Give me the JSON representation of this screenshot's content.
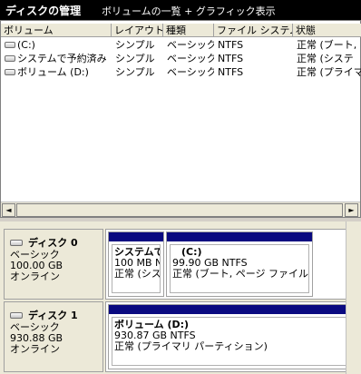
{
  "titlebar": {
    "title": "ディスクの管理",
    "view": "ボリュームの一覧 + グラフィック表示"
  },
  "columns": [
    {
      "label": "ボリューム"
    },
    {
      "label": "レイアウト"
    },
    {
      "label": "種類"
    },
    {
      "label": "ファイル システム"
    },
    {
      "label": "状態"
    }
  ],
  "volumes": [
    {
      "name": "(C:)",
      "layout": "シンプル",
      "type": "ベーシック",
      "fs": "NTFS",
      "status": "正常 (ブート,"
    },
    {
      "name": "システムで予約済み",
      "layout": "シンプル",
      "type": "ベーシック",
      "fs": "NTFS",
      "status": "正常 (システ"
    },
    {
      "name": "ボリューム (D:)",
      "layout": "シンプル",
      "type": "ベーシック",
      "fs": "NTFS",
      "status": "正常 (プライマ"
    }
  ],
  "scrollbar": {
    "left_arrow": "◄",
    "right_arrow": "►"
  },
  "disks": [
    {
      "name": "ディスク 0",
      "type": "ベーシック",
      "size": "100.00 GB",
      "status": "オンライン",
      "partitions": [
        {
          "name": "システムで",
          "size": "100 MB N",
          "status": "正常 (シス"
        },
        {
          "name": "(C:)",
          "size": "99.90 GB NTFS",
          "status": "正常 (ブート, ページ ファイル, ク"
        }
      ]
    },
    {
      "name": "ディスク 1",
      "type": "ベーシック",
      "size": "930.88 GB",
      "status": "オンライン",
      "partitions": [
        {
          "name": "ボリューム  (D:)",
          "size": "930.87 GB NTFS",
          "status": "正常 (プライマリ パーティション)"
        }
      ]
    }
  ]
}
